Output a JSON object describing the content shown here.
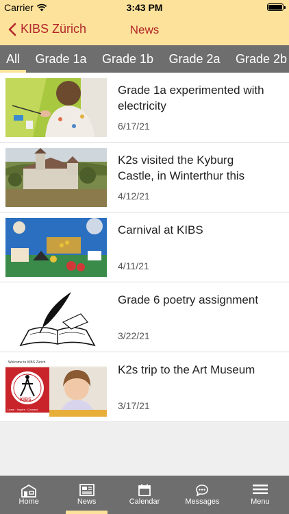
{
  "status_bar": {
    "carrier": "Carrier",
    "time": "3:43 PM"
  },
  "nav": {
    "back_label": "KIBS Zürich",
    "title": "News"
  },
  "tabs": [
    {
      "label": "All",
      "active": true
    },
    {
      "label": "Grade 1a"
    },
    {
      "label": "Grade 1b"
    },
    {
      "label": "Grade 2a"
    },
    {
      "label": "Grade 2b"
    }
  ],
  "news": [
    {
      "headline": "Grade 1a experimented with electricity",
      "date": "6/17/21",
      "image": "child-experiment-photo"
    },
    {
      "headline": "K2s visited the Kyburg Castle, in Winterthur this",
      "date": "4/12/21",
      "image": "castle-photo"
    },
    {
      "headline": "Carnival at KIBS",
      "date": "4/11/21",
      "image": "carnival-artwork-photo"
    },
    {
      "headline": "Grade 6 poetry assignment",
      "date": "3/22/21",
      "image": "quill-book-drawing"
    },
    {
      "headline": "K2s trip to the Art Museum",
      "date": "3/17/21",
      "image": "kibs-welcome-banner"
    }
  ],
  "thumb_banner": {
    "welcome": "Welcome to KIBS Zürich",
    "logo": "KIBS",
    "tagline": "Learn · Inspire · Connect"
  },
  "tab_bar": [
    {
      "label": "Home",
      "icon": "home-icon"
    },
    {
      "label": "News",
      "icon": "news-icon",
      "active": true
    },
    {
      "label": "Calendar",
      "icon": "calendar-icon"
    },
    {
      "label": "Messages",
      "icon": "messages-icon"
    },
    {
      "label": "Menu",
      "icon": "menu-icon"
    }
  ],
  "colors": {
    "header": "#fce29a",
    "accent": "#b3262a",
    "tabs_bg": "#6e6e6e"
  }
}
